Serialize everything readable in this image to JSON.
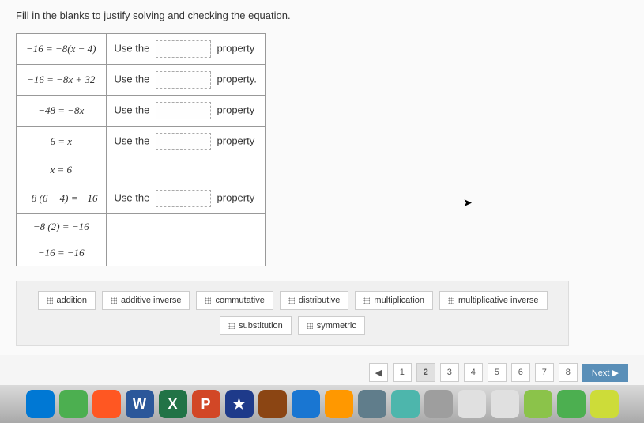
{
  "instruction": "Fill in the blanks to justify solving and checking the equation.",
  "rows": [
    {
      "equation": "−16 = −8(x − 4)",
      "prefix": "Use the",
      "suffix": "property"
    },
    {
      "equation": "−16 = −8x + 32",
      "prefix": "Use the",
      "suffix": "property."
    },
    {
      "equation": "−48 = −8x",
      "prefix": "Use the",
      "suffix": "property"
    },
    {
      "equation": "6 = x",
      "prefix": "Use the",
      "suffix": "property"
    },
    {
      "equation": "x = 6",
      "prefix": "",
      "suffix": ""
    },
    {
      "equation": "−8 (6 − 4) = −16",
      "prefix": "Use the",
      "suffix": "property"
    },
    {
      "equation": "−8 (2) = −16",
      "prefix": "",
      "suffix": ""
    },
    {
      "equation": "−16 = −16",
      "prefix": "",
      "suffix": ""
    }
  ],
  "wordBank": [
    "addition",
    "additive inverse",
    "commutative",
    "distributive",
    "multiplication",
    "multiplicative inverse",
    "substitution",
    "symmetric"
  ],
  "pagination": {
    "prev": "◀",
    "pages": [
      "1",
      "2",
      "3",
      "4",
      "5",
      "6",
      "7",
      "8"
    ],
    "current": "2",
    "next": "Next ▶"
  },
  "dock": [
    {
      "bg": "#0078d4",
      "label": ""
    },
    {
      "bg": "#4caf50",
      "label": ""
    },
    {
      "bg": "#ff5722",
      "label": ""
    },
    {
      "bg": "#2b579a",
      "label": "W"
    },
    {
      "bg": "#217346",
      "label": "X"
    },
    {
      "bg": "#d24726",
      "label": "P"
    },
    {
      "bg": "#1e3a8a",
      "label": "★"
    },
    {
      "bg": "#8b4513",
      "label": ""
    },
    {
      "bg": "#1976d2",
      "label": ""
    },
    {
      "bg": "#ff9800",
      "label": ""
    },
    {
      "bg": "#607d8b",
      "label": ""
    },
    {
      "bg": "#4db6ac",
      "label": ""
    },
    {
      "bg": "#9e9e9e",
      "label": ""
    },
    {
      "bg": "#e0e0e0",
      "label": ""
    },
    {
      "bg": "#e0e0e0",
      "label": ""
    },
    {
      "bg": "#8bc34a",
      "label": ""
    },
    {
      "bg": "#4caf50",
      "label": ""
    },
    {
      "bg": "#cddc39",
      "label": ""
    }
  ]
}
